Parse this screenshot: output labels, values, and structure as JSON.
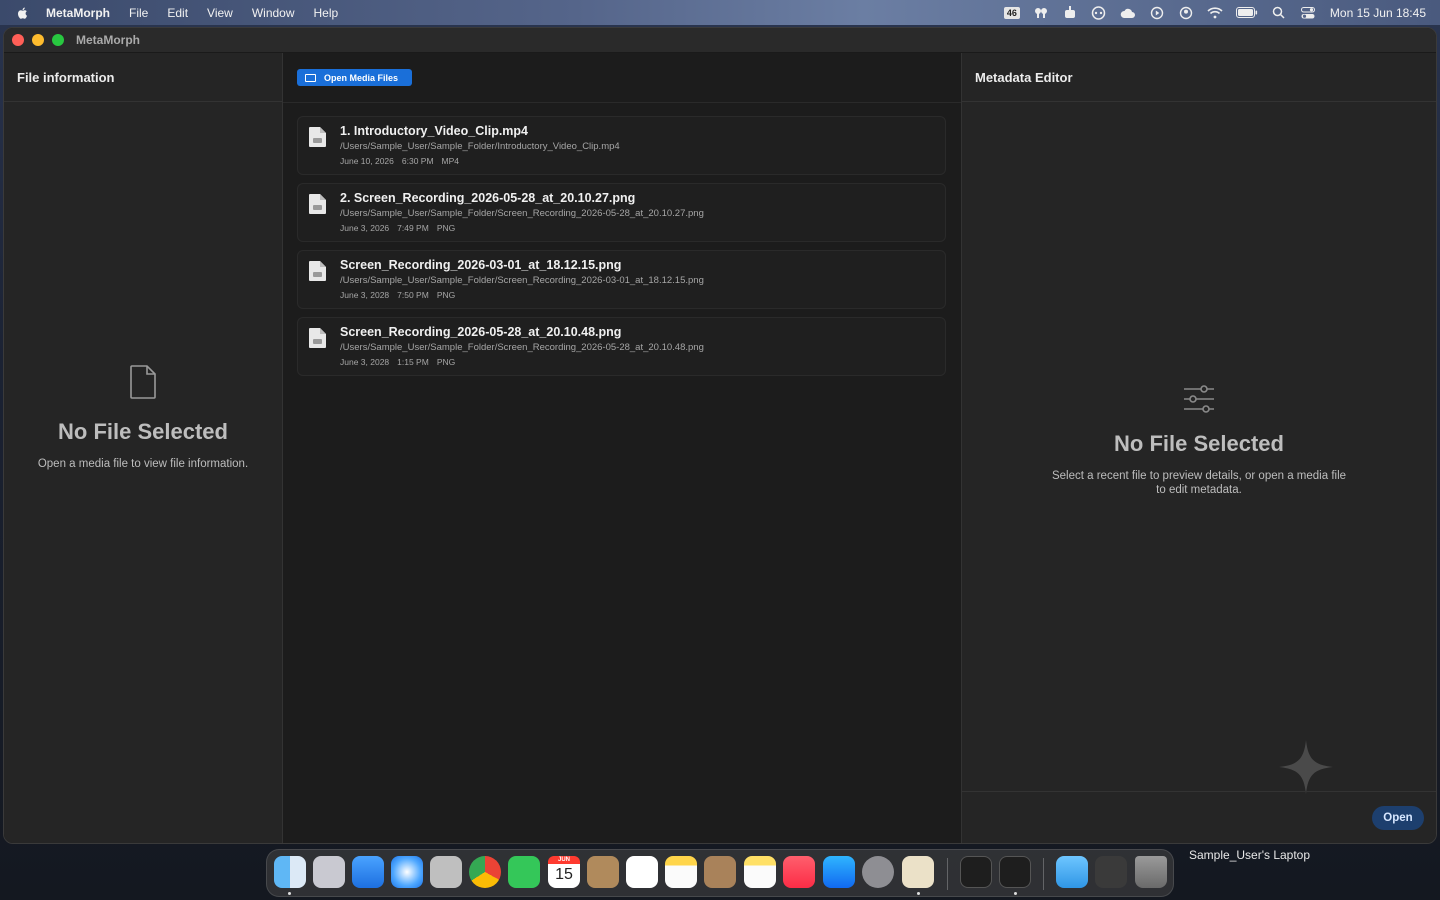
{
  "menubar": {
    "app_name": "MetaMorph",
    "menus": [
      "File",
      "Edit",
      "View",
      "Window",
      "Help"
    ],
    "status_badge": "46",
    "clock": "Mon 15 Jun  18:45"
  },
  "window": {
    "title": "MetaMorph"
  },
  "left_pane": {
    "header": "File information",
    "empty_title": "No File Selected",
    "empty_subtitle": "Open a media file to view file information."
  },
  "middle_pane": {
    "open_button_label": "Open Media Files",
    "files": [
      {
        "name": "1. Introductory_Video_Clip.mp4",
        "path": "/Users/Sample_User/Sample_Folder/Introductory_Video_Clip.mp4",
        "date": "June 10, 2026",
        "time": "6:30 PM",
        "type": "MP4"
      },
      {
        "name": "2. Screen_Recording_2026-05-28_at_20.10.27.png",
        "path": "/Users/Sample_User/Sample_Folder/Screen_Recording_2026-05-28_at_20.10.27.png",
        "date": "June 3, 2026",
        "time": "7:49 PM",
        "type": "PNG"
      },
      {
        "name": "Screen_Recording_2026-03-01_at_18.12.15.png",
        "path": "/Users/Sample_User/Sample_Folder/Screen_Recording_2026-03-01_at_18.12.15.png",
        "date": "June 3, 2028",
        "time": "7:50 PM",
        "type": "PNG"
      },
      {
        "name": "Screen_Recording_2026-05-28_at_20.10.48.png",
        "path": "/Users/Sample_User/Sample_Folder/Screen_Recording_2026-05-28_at_20.10.48.png",
        "date": "June 3, 2028",
        "time": "1:15 PM",
        "type": "PNG"
      }
    ]
  },
  "right_pane": {
    "header": "Metadata Editor",
    "empty_title": "No File Selected",
    "empty_subtitle_line1": "Select a recent file to preview details, or open a media file",
    "empty_subtitle_line2": "to edit metadata.",
    "open_button_label": "Open"
  },
  "dock": {
    "calendar_month": "JUN",
    "calendar_day": "15",
    "hostname": "Sample_User's Laptop"
  },
  "colors": {
    "accent": "#1a6fd9",
    "open_button": "#1d3f6e"
  }
}
